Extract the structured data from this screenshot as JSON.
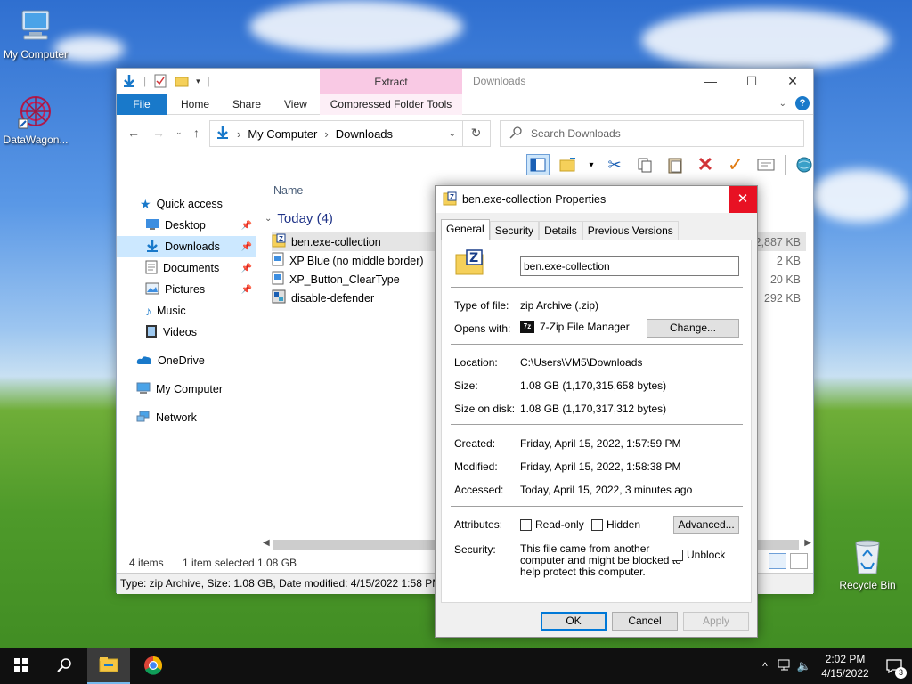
{
  "desktop": {
    "icons": [
      {
        "label": "My Computer"
      },
      {
        "label": "DataWagon..."
      },
      {
        "label": "Recycle Bin"
      }
    ]
  },
  "explorer": {
    "title": "Downloads",
    "ribbon": {
      "extract_label": "Extract",
      "tabs": {
        "file": "File",
        "home": "Home",
        "share": "Share",
        "view": "View",
        "compressed": "Compressed Folder Tools"
      }
    },
    "address": {
      "segments": [
        "My Computer",
        "Downloads"
      ]
    },
    "search": {
      "placeholder": "Search Downloads"
    },
    "nav": {
      "quick_access": "Quick access",
      "desktop": "Desktop",
      "downloads": "Downloads",
      "documents": "Documents",
      "pictures": "Pictures",
      "music": "Music",
      "videos": "Videos",
      "onedrive": "OneDrive",
      "mycomputer": "My Computer",
      "network": "Network"
    },
    "files": {
      "column_name": "Name",
      "group_label": "Today (4)",
      "rows": [
        {
          "name": "ben.exe-collection",
          "size": "42,887 KB"
        },
        {
          "name": "XP Blue (no middle border)",
          "size": "2 KB"
        },
        {
          "name": "XP_Button_ClearType",
          "size": "20 KB"
        },
        {
          "name": "disable-defender",
          "size": "292 KB"
        }
      ]
    },
    "status": {
      "items": "4 items",
      "selected": "1 item selected",
      "selected_size": "1.08 GB"
    },
    "details_bar": "Type: zip Archive, Size: 1.08 GB, Date modified: 4/15/2022 1:58 PM"
  },
  "properties": {
    "title": "ben.exe-collection Properties",
    "tabs": [
      "General",
      "Security",
      "Details",
      "Previous Versions"
    ],
    "name_value": "ben.exe-collection",
    "type_label": "Type of file:",
    "type_value": "zip Archive (.zip)",
    "opens_label": "Opens with:",
    "opens_value": "7-Zip File Manager",
    "change_btn": "Change...",
    "location_label": "Location:",
    "location_value": "C:\\Users\\VM5\\Downloads",
    "size_label": "Size:",
    "size_value": "1.08 GB (1,170,315,658 bytes)",
    "size_disk_label": "Size on disk:",
    "size_disk_value": "1.08 GB (1,170,317,312 bytes)",
    "created_label": "Created:",
    "created_value": "Friday, April 15, 2022, 1:57:59 PM",
    "modified_label": "Modified:",
    "modified_value": "Friday, April 15, 2022, 1:58:38 PM",
    "accessed_label": "Accessed:",
    "accessed_value": "Today, April 15, 2022, 3 minutes ago",
    "attributes_label": "Attributes:",
    "readonly_label": "Read-only",
    "hidden_label": "Hidden",
    "advanced_btn": "Advanced...",
    "security_label": "Security:",
    "security_line1": "This file came from another",
    "security_line2": "computer and might be blocked to",
    "security_line3": "help protect this computer.",
    "unblock_label": "Unblock",
    "ok_btn": "OK",
    "cancel_btn": "Cancel",
    "apply_btn": "Apply"
  },
  "taskbar": {
    "time": "2:02 PM",
    "date": "4/15/2022",
    "notification_count": "3"
  }
}
